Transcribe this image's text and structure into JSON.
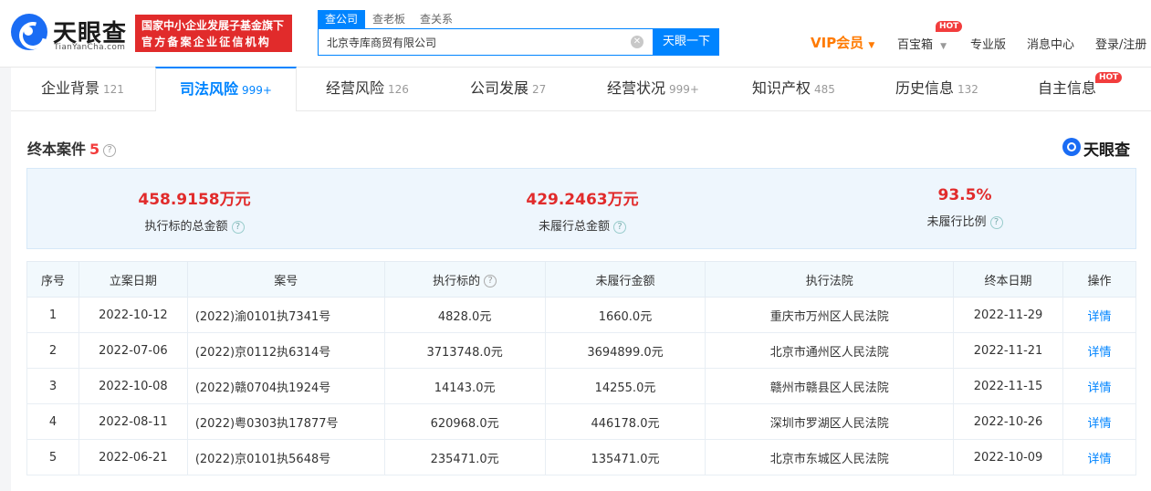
{
  "header": {
    "brand_name": "天眼查",
    "brand_en": "TianYanCha.com",
    "promo_line1": "国家中小企业发展子基金旗下",
    "promo_line2": "官方备案企业征信机构",
    "search_tabs": [
      "查公司",
      "查老板",
      "查关系"
    ],
    "search_value": "北京寺库商贸有限公司",
    "search_button": "天眼一下",
    "vip": "VIP会员",
    "baibaoxiang": "百宝箱",
    "hot": "HOT",
    "pro": "专业版",
    "messages": "消息中心",
    "login": "登录/注册"
  },
  "tabs": [
    {
      "label": "企业背景",
      "count": "121"
    },
    {
      "label": "司法风险",
      "count": "999+"
    },
    {
      "label": "经营风险",
      "count": "126"
    },
    {
      "label": "公司发展",
      "count": "27"
    },
    {
      "label": "经营状况",
      "count": "999+"
    },
    {
      "label": "知识产权",
      "count": "485"
    },
    {
      "label": "历史信息",
      "count": "132"
    },
    {
      "label": "自主信息",
      "count": ""
    }
  ],
  "section": {
    "title": "终本案件",
    "count": "5",
    "help": "?",
    "watermark": "天眼查"
  },
  "summary": [
    {
      "value": "458.9158万元",
      "label": "执行标的总金额"
    },
    {
      "value": "429.2463万元",
      "label": "未履行总金额"
    },
    {
      "value": "93.5%",
      "label": "未履行比例"
    }
  ],
  "table": {
    "headers": [
      "序号",
      "立案日期",
      "案号",
      "执行标的",
      "未履行金额",
      "执行法院",
      "终本日期",
      "操作"
    ],
    "rows": [
      [
        "1",
        "2022-10-12",
        "(2022)渝0101执7341号",
        "4828.0元",
        "1660.0元",
        "重庆市万州区人民法院",
        "2022-11-29",
        "详情"
      ],
      [
        "2",
        "2022-07-06",
        "(2022)京0112执6314号",
        "3713748.0元",
        "3694899.0元",
        "北京市通州区人民法院",
        "2022-11-21",
        "详情"
      ],
      [
        "3",
        "2022-10-08",
        "(2022)赣0704执1924号",
        "14143.0元",
        "14255.0元",
        "赣州市赣县区人民法院",
        "2022-11-15",
        "详情"
      ],
      [
        "4",
        "2022-08-11",
        "(2022)粤0303执17877号",
        "620968.0元",
        "446178.0元",
        "深圳市罗湖区人民法院",
        "2022-10-26",
        "详情"
      ],
      [
        "5",
        "2022-06-21",
        "(2022)京0101执5648号",
        "235471.0元",
        "135471.0元",
        "北京市东城区人民法院",
        "2022-10-09",
        "详情"
      ]
    ]
  }
}
